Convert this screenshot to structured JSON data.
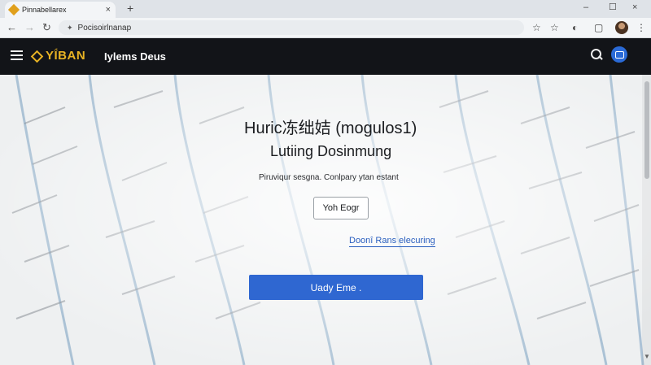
{
  "browser": {
    "tab": {
      "title": "Pinnabellarex",
      "favicon": "diamond-icon",
      "close": "×"
    },
    "new_tab": "+",
    "window_controls": [
      "–",
      "☐",
      "×"
    ],
    "nav": {
      "back": "←",
      "forward": "→",
      "reload": "↻"
    },
    "address": {
      "lock_icon": "✦",
      "text": "Pocisoirlnanap"
    },
    "toolbar_icons": [
      "☆",
      "☆",
      "◐",
      "▢"
    ],
    "menu": "⋮"
  },
  "header": {
    "logo_text": "YḮBAN",
    "site_title": "Iylems Deus",
    "colors": {
      "background": "#121418",
      "logo": "#e8b324",
      "accent": "#2a6ad6"
    }
  },
  "main": {
    "headline": "Huric冻绌姞 (mogulos1)",
    "subheadline": "Lutiing Dosinmung",
    "tagline": "Piruviqur sesgna. Conlpary ytan estant",
    "outline_button": "Yoh Eogr",
    "link": "Doonî Rans elecuring",
    "primary_button": "Uady Eme .",
    "colors": {
      "primary": "#2f67d1",
      "link": "#2a5fbf"
    }
  }
}
